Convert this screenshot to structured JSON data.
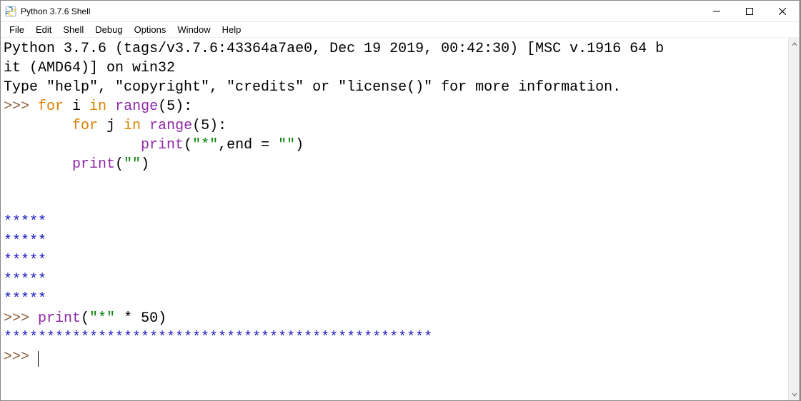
{
  "window": {
    "title": "Python 3.7.6 Shell",
    "icon": "python-idle-icon"
  },
  "menu": {
    "file": "File",
    "edit": "Edit",
    "shell": "Shell",
    "debug": "Debug",
    "options": "Options",
    "window": "Window",
    "help": "Help"
  },
  "editor": {
    "banner_line1": "Python 3.7.6 (tags/v3.7.6:43364a7ae0, Dec 19 2019, 00:42:30) [MSC v.1916 64 b",
    "banner_line2": "it (AMD64)] on win32",
    "banner_line3": "Type \"help\", \"copyright\", \"credits\" or \"license()\" for more information.",
    "prompt": ">>> ",
    "code1": {
      "for1": "for",
      "i": " i ",
      "in1": "in",
      "range1": " range",
      "args1": "(5):",
      "indent2": "        ",
      "for2": "for",
      "j": " j ",
      "in2": "in",
      "range2": " range",
      "args2": "(5):",
      "indent3": "                ",
      "print1": "print",
      "pargs1a": "(",
      "pstr1": "\"*\"",
      "pargs1b": ",end = ",
      "pstr1b": "\"\"",
      "pargs1c": ")",
      "indent2b": "        ",
      "print2": "print",
      "pargs2a": "(",
      "pstr2": "\"\"",
      "pargs2b": ")",
      "blank": " ",
      "out1": "*****",
      "out2": "*****",
      "out3": "*****",
      "out4": "*****",
      "out5": "*****"
    },
    "code2": {
      "print": "print",
      "pa": "(",
      "str": "\"*\"",
      "mid": " * 50)",
      "out": "**************************************************"
    }
  }
}
